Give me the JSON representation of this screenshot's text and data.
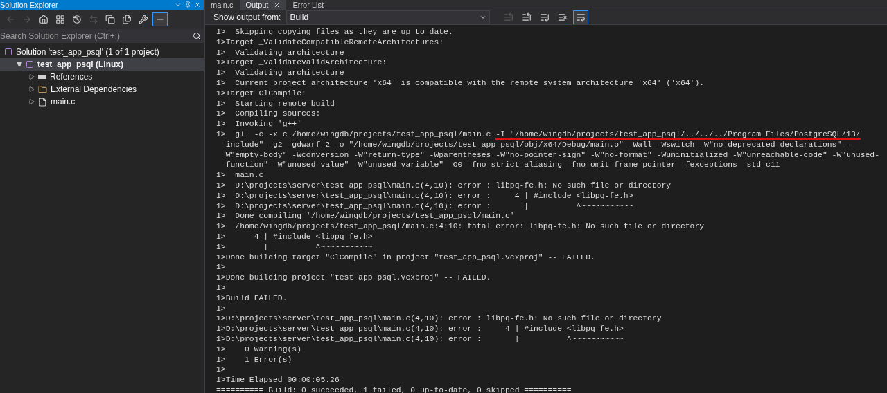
{
  "solution_explorer": {
    "title": "Solution Explorer",
    "toolbar": [
      {
        "kind": "back",
        "disabled": true,
        "selected": false
      },
      {
        "kind": "forward",
        "disabled": true,
        "selected": false
      },
      {
        "kind": "home",
        "disabled": false,
        "selected": false
      },
      {
        "kind": "switch-views",
        "disabled": false,
        "selected": false
      },
      {
        "kind": "history",
        "disabled": false,
        "selected": false
      },
      {
        "kind": "sync",
        "disabled": true,
        "selected": false
      },
      {
        "kind": "collapse",
        "disabled": false,
        "selected": false
      },
      {
        "kind": "show-all",
        "disabled": false,
        "selected": false
      },
      {
        "kind": "properties",
        "disabled": false,
        "selected": false
      },
      {
        "kind": "preview",
        "disabled": false,
        "selected": true
      }
    ],
    "search": {
      "placeholder": "Search Solution Explorer (Ctrl+;)"
    },
    "tree": [
      {
        "label": "Solution 'test_app_psql' (1 of 1 project)",
        "kind": "solution",
        "bold": false,
        "selected": false,
        "children": [
          {
            "label": "test_app_psql (Linux)",
            "kind": "project",
            "bold": true,
            "selected": true,
            "expanded": true,
            "children": [
              {
                "label": "References",
                "kind": "references",
                "bold": false,
                "selected": false,
                "expanded": false
              },
              {
                "label": "External Dependencies",
                "kind": "folder",
                "bold": false,
                "selected": false,
                "expanded": false
              },
              {
                "label": "main.c",
                "kind": "file",
                "bold": false,
                "selected": false,
                "expanded": false
              }
            ]
          }
        ]
      }
    ]
  },
  "tabs": [
    {
      "label": "main.c",
      "selected": false
    },
    {
      "label": "Output",
      "selected": true
    },
    {
      "label": "Error List",
      "selected": false
    }
  ],
  "output": {
    "source_label": "Show output from:",
    "source_value": "Build",
    "toolbar": [
      {
        "kind": "goto",
        "disabled": true,
        "selected": false
      },
      {
        "kind": "prev",
        "disabled": false,
        "selected": false
      },
      {
        "kind": "next",
        "disabled": false,
        "selected": false
      },
      {
        "kind": "clear",
        "disabled": false,
        "selected": false
      },
      {
        "kind": "wrap",
        "disabled": false,
        "selected": true
      }
    ],
    "lines": [
      {
        "text": "1>  Skipping copying files as they are up to date."
      },
      {
        "text": "1>Target _ValidateCompatibleRemoteArchitectures:"
      },
      {
        "text": "1>  Validating architecture"
      },
      {
        "text": "1>Target _ValidateValidArchitecture:"
      },
      {
        "text": "1>  Validating architecture"
      },
      {
        "text": "1>  Current project architecture 'x64' is compatible with the remote system architecture 'x64' ('x64')."
      },
      {
        "text": "1>Target ClCompile:"
      },
      {
        "text": "1>  Starting remote build"
      },
      {
        "text": "1>  Compiling sources:"
      },
      {
        "text": "1>  Invoking 'g++'"
      },
      {
        "text": "1>  g++ -c -x c /home/wingdb/projects/test_app_psql/main.c ",
        "underlined": "-I \"/home/wingdb/projects/test_app_psql/../../../Program Files/PostgreSQL/13/"
      },
      {
        "text": "  include\" -g2 -gdwarf-2 -o \"/home/wingdb/projects/test_app_psql/obj/x64/Debug/main.o\" -Wall -Wswitch -W\"no-deprecated-declarations\" -"
      },
      {
        "text": "  W\"empty-body\" -Wconversion -W\"return-type\" -Wparentheses -W\"no-pointer-sign\" -W\"no-format\" -Wuninitialized -W\"unreachable-code\" -W\"unused-"
      },
      {
        "text": "  function\" -W\"unused-value\" -W\"unused-variable\" -O0 -fno-strict-aliasing -fno-omit-frame-pointer -fexceptions -std=c11"
      },
      {
        "text": "1>  main.c"
      },
      {
        "text": "1>  D:\\projects\\server\\test_app_psql\\main.c(4,10): error : libpq-fe.h: No such file or directory"
      },
      {
        "text": "1>  D:\\projects\\server\\test_app_psql\\main.c(4,10): error :     4 | #include <libpq-fe.h>"
      },
      {
        "text": "1>  D:\\projects\\server\\test_app_psql\\main.c(4,10): error :       |          ^~~~~~~~~~~~"
      },
      {
        "text": "1>  Done compiling '/home/wingdb/projects/test_app_psql/main.c'"
      },
      {
        "text": "1>  /home/wingdb/projects/test_app_psql/main.c:4:10: fatal error: libpq-fe.h: No such file or directory"
      },
      {
        "text": "1>      4 | #include <libpq-fe.h>"
      },
      {
        "text": "1>        |          ^~~~~~~~~~~~"
      },
      {
        "text": "1>Done building target \"ClCompile\" in project \"test_app_psql.vcxproj\" -- FAILED."
      },
      {
        "text": "1>"
      },
      {
        "text": "1>Done building project \"test_app_psql.vcxproj\" -- FAILED."
      },
      {
        "text": "1>"
      },
      {
        "text": "1>Build FAILED."
      },
      {
        "text": "1>"
      },
      {
        "text": "1>D:\\projects\\server\\test_app_psql\\main.c(4,10): error : libpq-fe.h: No such file or directory"
      },
      {
        "text": "1>D:\\projects\\server\\test_app_psql\\main.c(4,10): error :     4 | #include <libpq-fe.h>"
      },
      {
        "text": "1>D:\\projects\\server\\test_app_psql\\main.c(4,10): error :       |          ^~~~~~~~~~~~"
      },
      {
        "text": "1>    0 Warning(s)"
      },
      {
        "text": "1>    1 Error(s)"
      },
      {
        "text": "1>"
      },
      {
        "text": "1>Time Elapsed 00:00:05.26"
      },
      {
        "text": "========== Build: 0 succeeded, 1 failed, 0 up-to-date, 0 skipped =========="
      }
    ]
  }
}
